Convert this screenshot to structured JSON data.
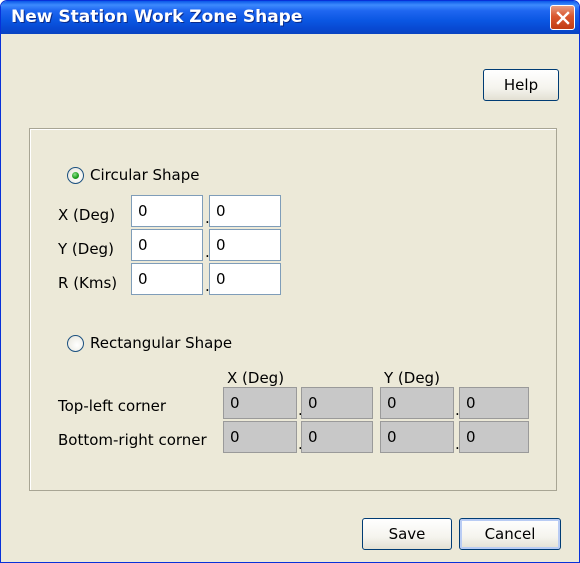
{
  "window": {
    "title": "New Station Work Zone Shape"
  },
  "buttons": {
    "help": "Help",
    "save": "Save",
    "cancel": "Cancel"
  },
  "circular": {
    "label": "Circular Shape",
    "selected": true,
    "rows": [
      {
        "label": "X (Deg)",
        "int": "0",
        "frac": "0"
      },
      {
        "label": "Y (Deg)",
        "int": "0",
        "frac": "0"
      },
      {
        "label": "R (Kms)",
        "int": "0",
        "frac": "0"
      }
    ]
  },
  "rectangular": {
    "label": "Rectangular Shape",
    "selected": false,
    "x_header": "X (Deg)",
    "y_header": "Y (Deg)",
    "rows": [
      {
        "label": "Top-left corner",
        "x_int": "0",
        "x_frac": "0",
        "y_int": "0",
        "y_frac": "0"
      },
      {
        "label": "Bottom-right corner",
        "x_int": "0",
        "x_frac": "0",
        "y_int": "0",
        "y_frac": "0"
      }
    ]
  },
  "separator": "."
}
